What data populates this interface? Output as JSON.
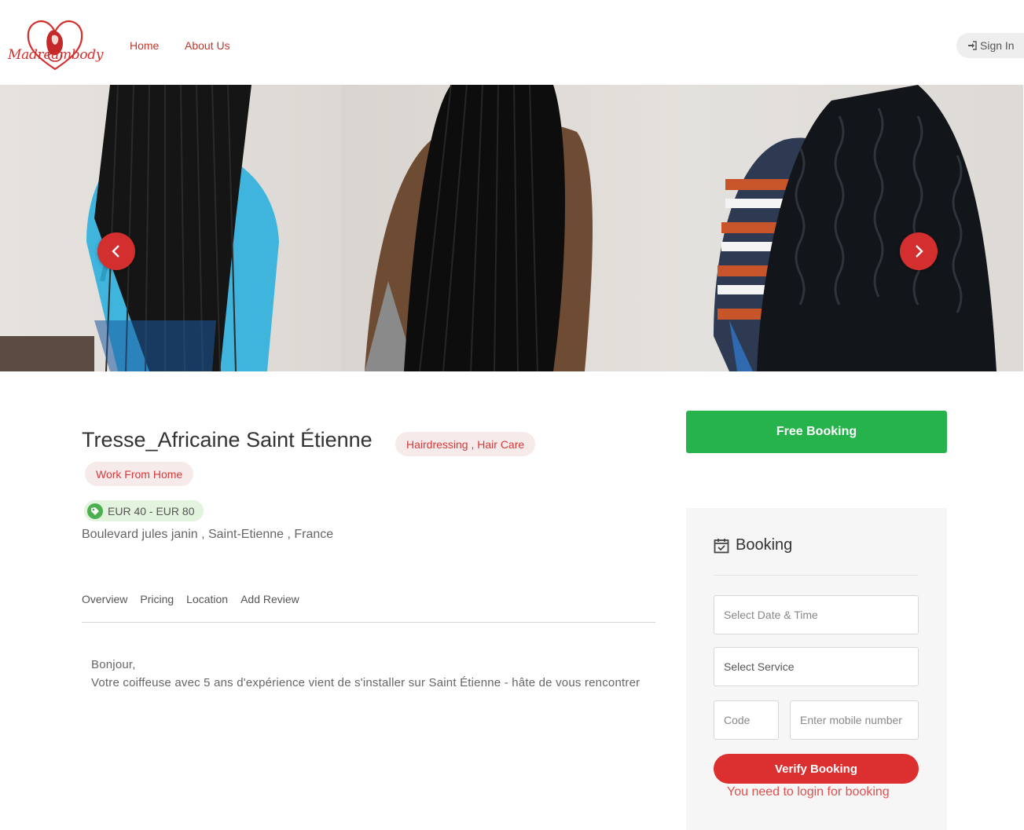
{
  "brand": {
    "logo_text": "Madreambody",
    "accent": "#d42f2f"
  },
  "nav": {
    "items": [
      {
        "label": "Home"
      },
      {
        "label": "About Us"
      }
    ],
    "signin_label": "Sign In",
    "signin_icon": "sign-in-icon"
  },
  "gallery": {
    "prev_icon": "chevron-left-icon",
    "next_icon": "chevron-right-icon"
  },
  "listing": {
    "title": "Tresse_Africaine Saint Étienne",
    "categories": "Hairdressing , Hair Care",
    "tag": "Work From Home",
    "price_range": "EUR 40 - EUR 80",
    "address": "Boulevard jules janin , Saint-Etienne , France"
  },
  "tabs": [
    {
      "label": "Overview"
    },
    {
      "label": "Pricing"
    },
    {
      "label": "Location"
    },
    {
      "label": "Add Review"
    }
  ],
  "description": {
    "line1": "Bonjour,",
    "line2": "Votre coiffeuse avec 5 ans d'expérience vient de s'installer sur Saint Étienne - hâte de vous rencontrer"
  },
  "booking": {
    "free_booking_label": "Free Booking",
    "title": "Booking",
    "date_placeholder": "Select Date & Time",
    "service_placeholder": "Select Service",
    "code_placeholder": "Code",
    "mobile_placeholder": "Enter mobile number",
    "verify_label": "Verify Booking",
    "login_message": "You need to login for booking"
  },
  "colors": {
    "green": "#27b34b",
    "red": "#dc2f2f",
    "pill_bg": "#f7eaea",
    "price_bg": "#e2f4dd"
  }
}
